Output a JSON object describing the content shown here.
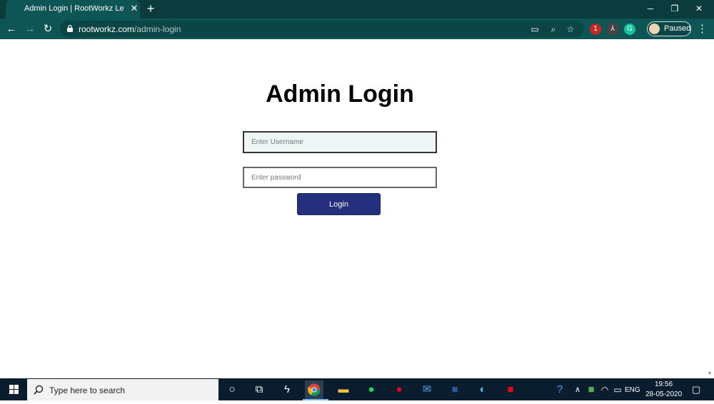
{
  "browser": {
    "tab_title": "Admin Login | RootWorkz Learnin",
    "url_host": "rootworkz.com",
    "url_path": "/admin-login",
    "profile_status": "Paused",
    "extension_badge": "1",
    "accent": "#0e5556"
  },
  "page": {
    "title": "Admin Login",
    "username_placeholder": "Enter Username",
    "username_value": "",
    "password_placeholder": "Enter password",
    "password_value": "",
    "login_label": "Login",
    "button_color": "#24307e"
  },
  "taskbar": {
    "search_placeholder": "Type here to search",
    "language": "ENG",
    "time": "19:56",
    "date": "28-05-2020"
  }
}
